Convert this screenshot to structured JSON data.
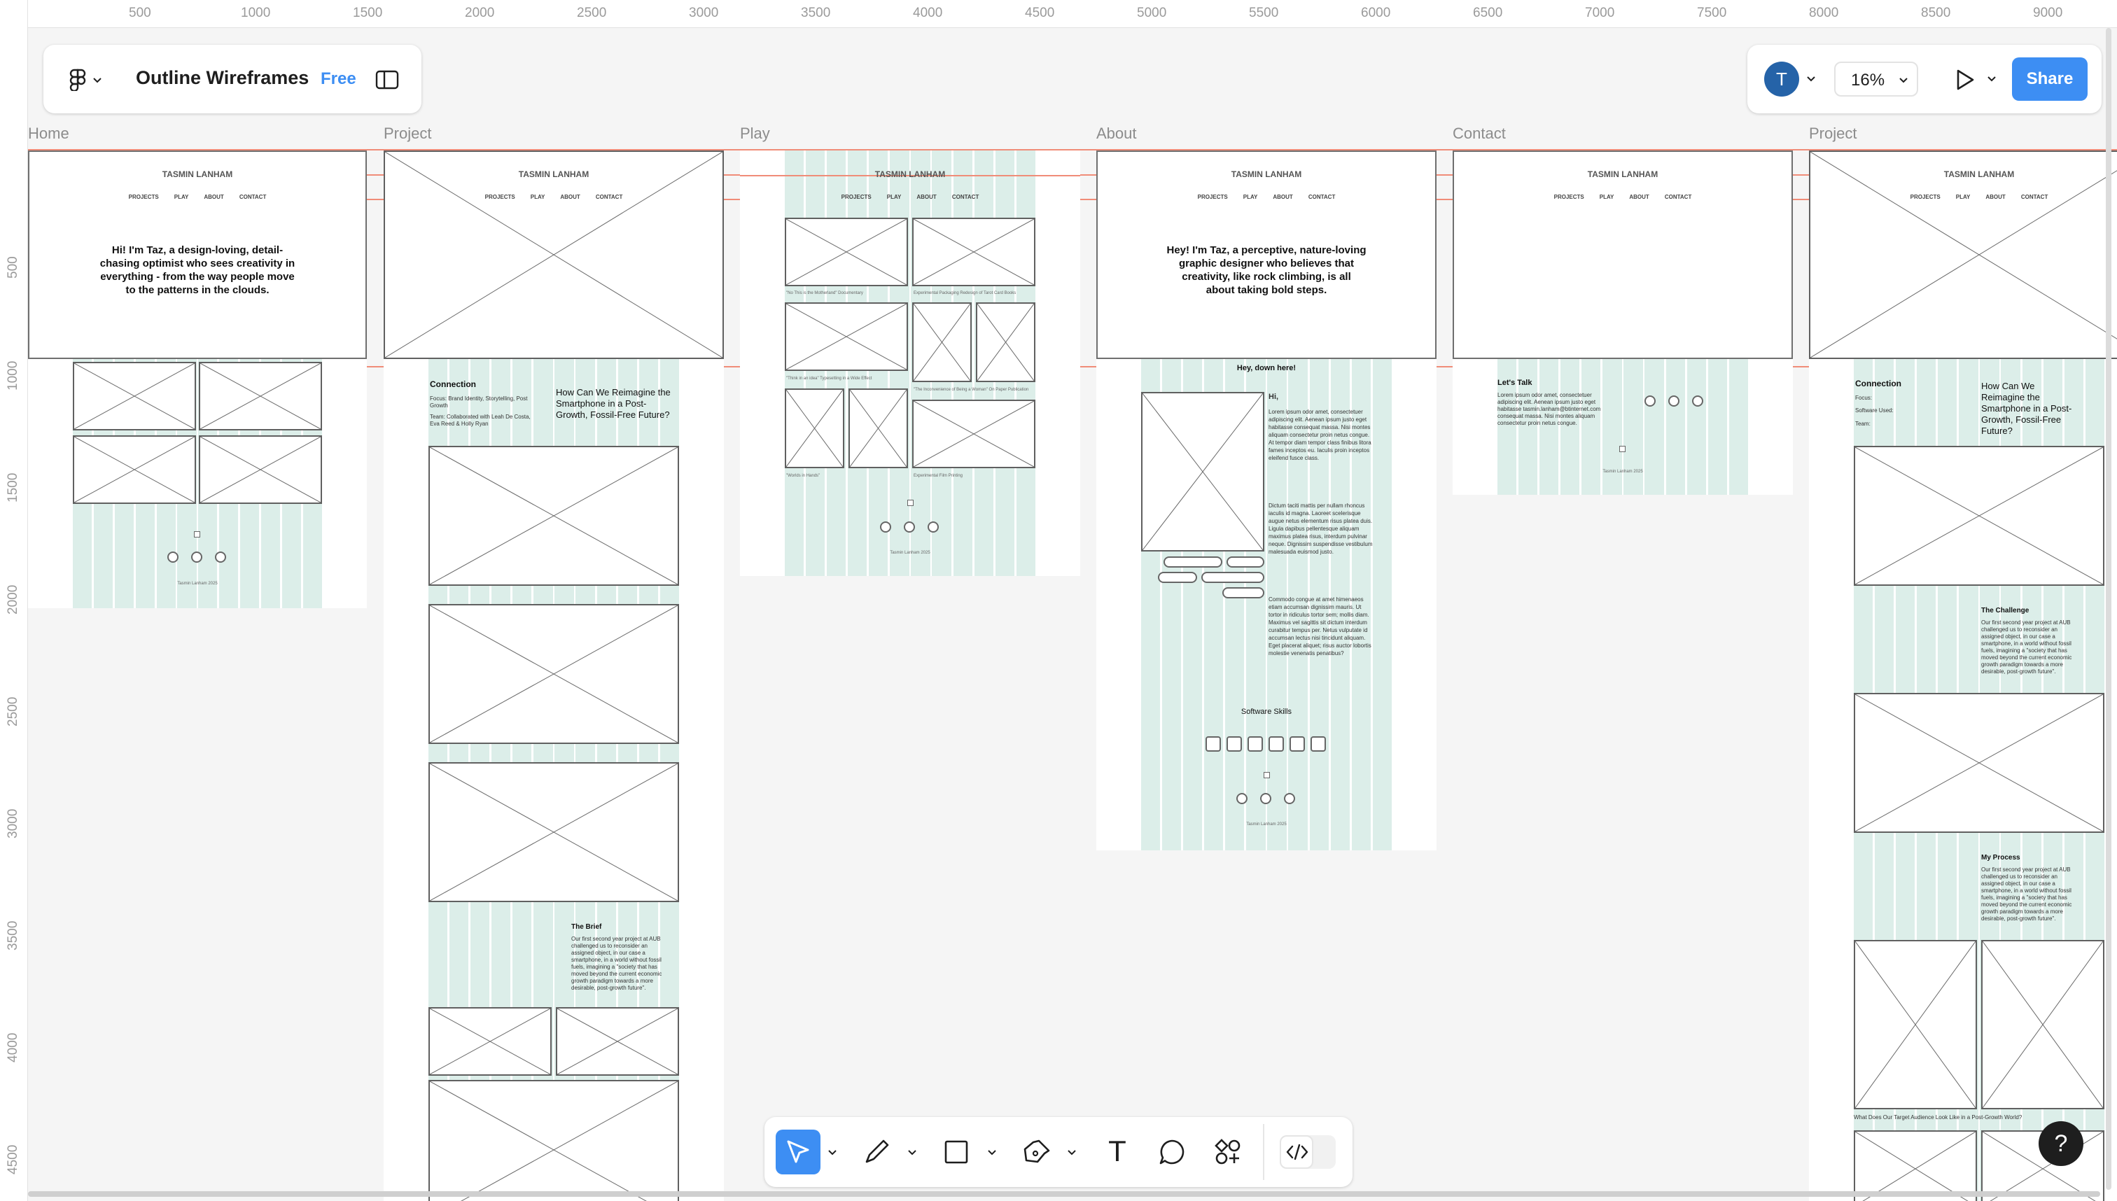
{
  "file": {
    "title": "Outline Wireframes",
    "plan": "Free"
  },
  "user": {
    "avatar_initial": "T"
  },
  "zoom": {
    "value": "16%"
  },
  "share": {
    "label": "Share"
  },
  "help": {
    "label": "?"
  },
  "ruler": {
    "top": [
      "500",
      "1000",
      "1500",
      "2000",
      "2500",
      "3000",
      "3500",
      "4000",
      "4500",
      "5000",
      "5500",
      "6000",
      "6500",
      "7000",
      "7500",
      "8000",
      "8500",
      "9000"
    ],
    "left": [
      "500",
      "1000",
      "1500",
      "2000",
      "2500",
      "3000",
      "3500",
      "4000",
      "4500"
    ]
  },
  "frames": {
    "home": "Home",
    "project": "Project",
    "play": "Play",
    "about": "About",
    "contact": "Contact",
    "project2": "Project"
  },
  "site": {
    "brand": "TASMIN LANHAM",
    "nav": [
      "PROJECTS",
      "PLAY",
      "ABOUT",
      "CONTACT"
    ],
    "footer": "Tasmin Lanham 2025"
  },
  "home": {
    "heading": "Hi! I'm Taz, a design-loving, detail-chasing optimist who sees creativity in everything - from the way people move to the patterns in the clouds."
  },
  "project": {
    "title": "Connection",
    "focus": "Focus: Brand Identity, Storytelling, Post Growth",
    "team": "Team: Collaborated with Leah De Costa, Eva Reed & Holly Ryan",
    "question": "How Can We Reimagine the Smartphone in a Post-Growth, Fossil-Free Future?",
    "brief_title": "The Brief",
    "brief_text": "Our first second year project at AUB challenged us to reconsider an assigned object, in our case a smartphone, in a world without fossil fuels, imagining a \"society that has moved beyond the current economic growth paradigm towards a more desirable, post-growth future\"."
  },
  "play": {
    "captions": [
      "\"No This is the Motherland\" Documentary",
      "Experimental Packaging Redesign of Tarot Card Books",
      "\"Think in an idea\" Typesetting in a Wide Effect",
      "\"The Inconvenience of Being a Woman\" On Paper Publication",
      "\"Worlds in Hands\"",
      "Experimental Film Printing"
    ]
  },
  "about": {
    "heading": "Hey! I'm Taz, a perceptive, nature-loving graphic designer who believes that creativity, like rock climbing, is all about taking bold steps.",
    "subheading": "Hey, down here!",
    "greeting": "Hi,",
    "p1": "Lorem ipsum odor amet, consectetuer adipiscing elit. Aenean ipsum justo eget habitasse consequat massa. Nisi montes aliquam consectetur proin netus congue. At tempor diam tempor class finibus litora fames inceptos eu. Iaculis proin inceptos eleifend fusce class.",
    "p2": "Dictum taciti mattis per nullam rhoncus iaculis id magna. Laoreet scelerisque augue netus elementum risus platea duis. Ligula dapibus pellentesque aliquam maximus platea risus, interdum pulvinar neque. Dignissim suspendisse vestibulum malesuada euismod justo.",
    "p3": "Commodo congue at amet himenaeos etiam accumsan dignissim mauris. Ut tortor in ridiculus tortor sem; mollis diam. Maximus vel sagittis sit dictum interdum curabitur tempus per. Netus vulputate id accumsan lectus nisi tincidunt aliquam. Eget placerat aliquet; risus auctor lobortis molestie venenatis penatibus?",
    "skills_title": "Software Skills"
  },
  "contact": {
    "title": "Let's Talk",
    "text": "Lorem ipsum odor amet, consectetuer adipiscing elit. Aenean ipsum justo eget habitasse tasmin.lanham@btinternet.com consequat massa. Nisi montes aliquam consectetur proin netus congue."
  },
  "project2": {
    "title": "Connection",
    "focus": "Focus:",
    "software": "Software Used:",
    "team": "Team:",
    "question": "How Can We Reimagine the Smartphone in a Post-Growth, Fossil-Free Future?",
    "challenge_title": "The Challenge",
    "challenge_text": "Our first second year project at AUB challenged us to reconsider an assigned object, in our case a smartphone, in a world without fossil fuels, imagining a \"society that has moved beyond the current economic growth paradigm towards a more desirable, post-growth future\".",
    "process_title": "My Process",
    "process_text": "Our first second year project at AUB challenged us to reconsider an assigned object, in our case a smartphone, in a world without fossil fuels, imagining a \"society that has moved beyond the current economic growth paradigm towards a more desirable, post-growth future\".",
    "audience": "What Does Our Target Audience Look Like in a Post-Growth World?"
  },
  "toolbar": {
    "tools": [
      {
        "name": "move-tool",
        "icon": "cursor-icon"
      },
      {
        "name": "pencil-tool",
        "icon": "pencil-icon"
      },
      {
        "name": "frame-tool",
        "icon": "square-icon"
      },
      {
        "name": "pen-tool",
        "icon": "pen-icon"
      },
      {
        "name": "text-tool",
        "icon": "text-icon"
      },
      {
        "name": "comment-tool",
        "icon": "comment-icon"
      },
      {
        "name": "actions-tool",
        "icon": "shapes-icon"
      },
      {
        "name": "dev-mode-toggle",
        "icon": "code-icon"
      }
    ],
    "text_tool_glyph": "T"
  },
  "colors": {
    "accent": "#3d8ef3",
    "guide": "#f08c78",
    "grid_column": "#dceee9",
    "avatar": "#2563a8",
    "canvas": "#f5f5f5"
  }
}
